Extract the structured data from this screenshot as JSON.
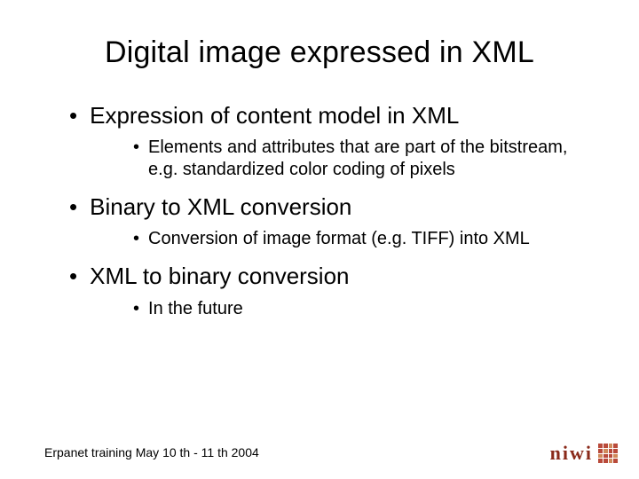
{
  "title": "Digital image expressed in XML",
  "bullets": [
    {
      "text": "Expression of content model in XML",
      "sub": [
        "Elements and attributes that are part of the bitstream, e.g. standardized color coding of pixels"
      ]
    },
    {
      "text": "Binary to XML conversion",
      "sub": [
        "Conversion of image format (e.g. TIFF) into XML"
      ]
    },
    {
      "text": "XML to binary conversion",
      "sub": [
        "In the future"
      ]
    }
  ],
  "footer": "Erpanet training May 10 th - 11 th 2004",
  "logo_text": "niwi"
}
